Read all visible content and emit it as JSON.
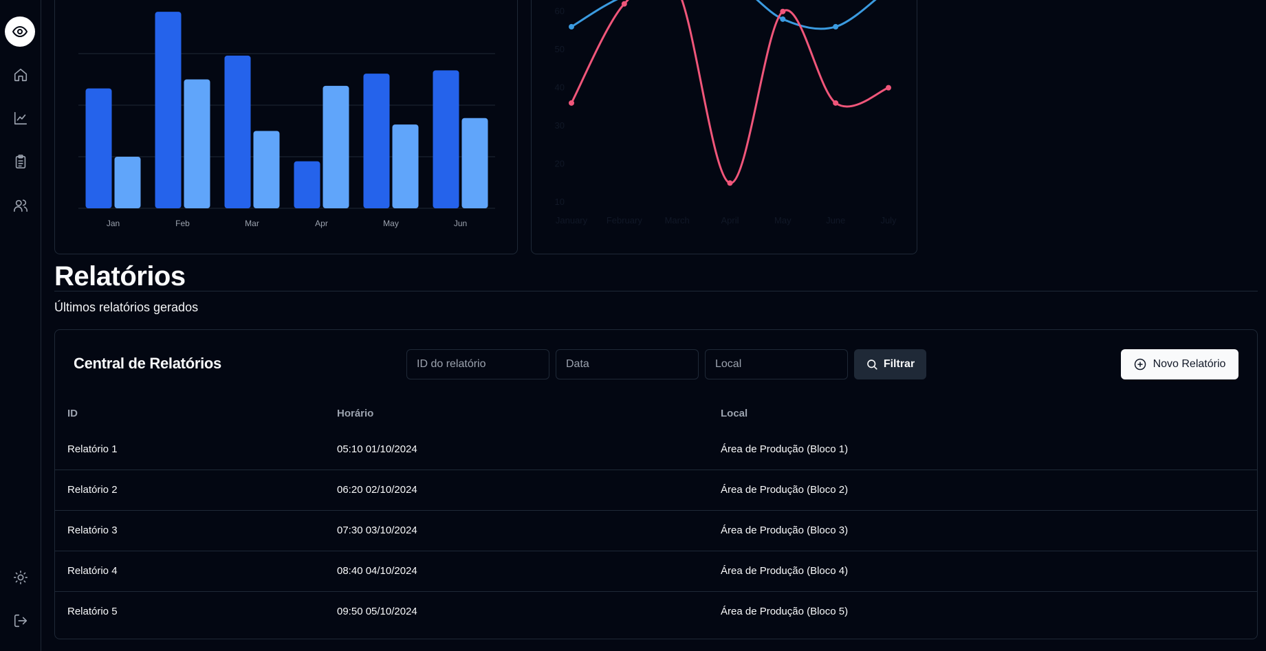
{
  "sidebar": {
    "items": [
      {
        "icon": "eye-icon",
        "active": true
      },
      {
        "icon": "home-icon"
      },
      {
        "icon": "chart-icon"
      },
      {
        "icon": "clipboard-list-icon"
      },
      {
        "icon": "users-icon"
      }
    ],
    "bottom": [
      {
        "icon": "sun-moon-icon"
      },
      {
        "icon": "logout-icon"
      }
    ]
  },
  "chart_data": [
    {
      "type": "bar",
      "categories": [
        "Jan",
        "Feb",
        "Mar",
        "Apr",
        "May",
        "Jun"
      ],
      "series": [
        {
          "values": [
            186,
            305,
            237,
            73,
            209,
            214
          ],
          "color": "#2563eb"
        },
        {
          "values": [
            80,
            200,
            120,
            190,
            130,
            140
          ],
          "color": "#60a5fa"
        }
      ],
      "ylim": [
        0,
        320
      ],
      "grid": true
    },
    {
      "type": "line",
      "categories": [
        "January",
        "February",
        "March",
        "April",
        "May",
        "June",
        "July"
      ],
      "yticks": [
        10,
        20,
        30,
        40,
        50,
        60
      ],
      "ylim": [
        10,
        65
      ],
      "series": [
        {
          "values": [
            56,
            64,
            66,
            68,
            58,
            56,
            66
          ],
          "color": "#3b9be0"
        },
        {
          "values": [
            36,
            62,
            66,
            15,
            60,
            36,
            40
          ],
          "color": "#f0567a"
        }
      ]
    }
  ],
  "section": {
    "title": "Relatórios",
    "subtitle": "Últimos relatórios gerados"
  },
  "reports": {
    "title": "Central de Relatórios",
    "filters": {
      "id_placeholder": "ID do relatório",
      "date_placeholder": "Data",
      "local_placeholder": "Local",
      "filter_label": "Filtrar"
    },
    "new_report_label": "Novo Relatório",
    "columns": [
      "ID",
      "Horário",
      "Local"
    ],
    "rows": [
      [
        "Relatório 1",
        "05:10 01/10/2024",
        "Área de Produção (Bloco 1)"
      ],
      [
        "Relatório 2",
        "06:20 02/10/2024",
        "Área de Produção (Bloco 2)"
      ],
      [
        "Relatório 3",
        "07:30 03/10/2024",
        "Área de Produção (Bloco 3)"
      ],
      [
        "Relatório 4",
        "08:40 04/10/2024",
        "Área de Produção (Bloco 4)"
      ],
      [
        "Relatório 5",
        "09:50 05/10/2024",
        "Área de Produção (Bloco 5)"
      ]
    ]
  }
}
